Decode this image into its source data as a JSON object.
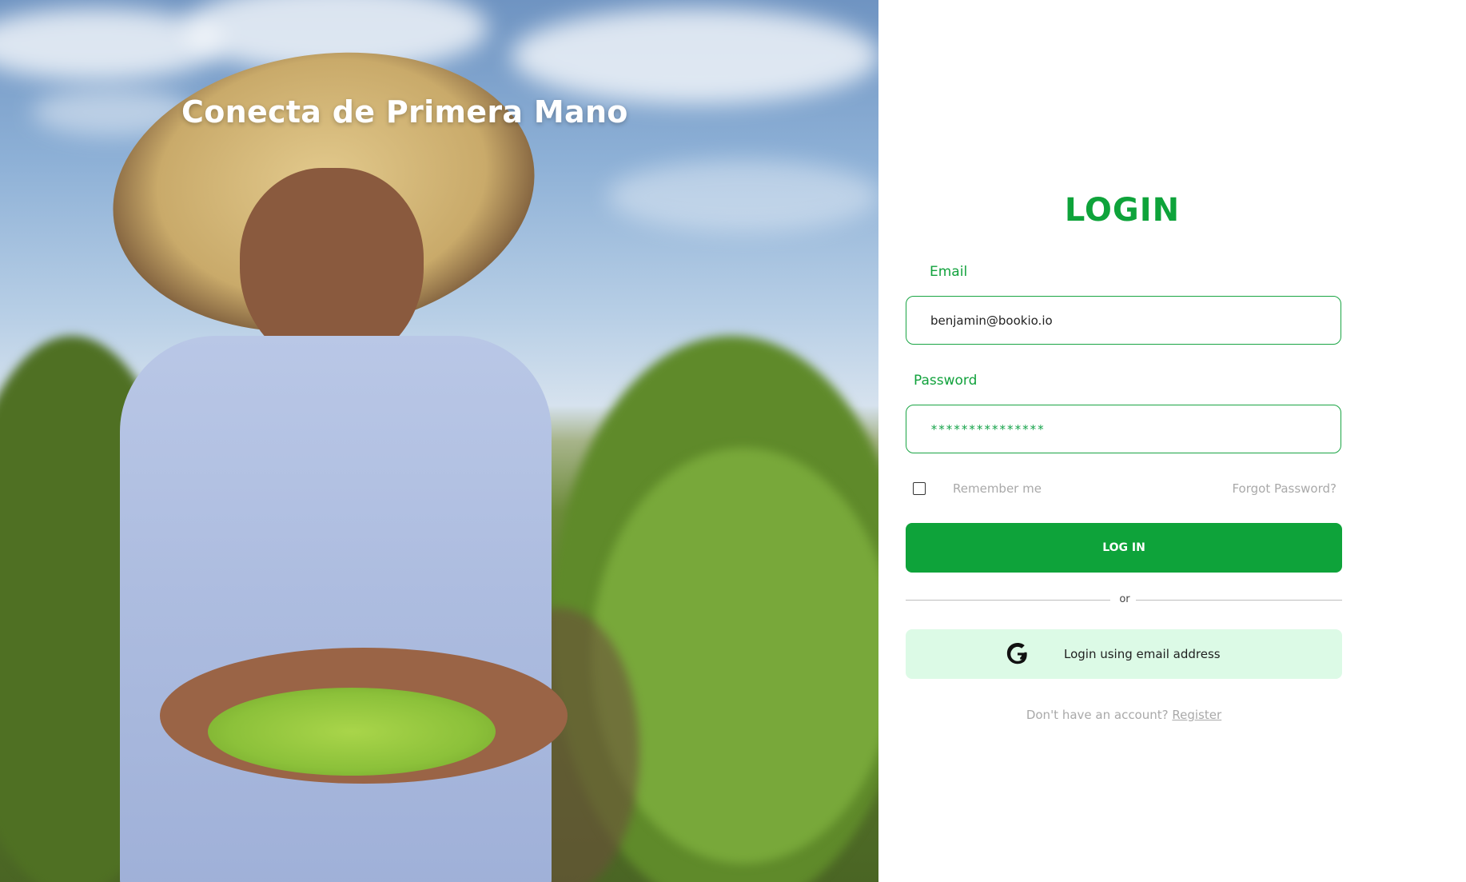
{
  "hero": {
    "title": "Conecta de Primera Mano"
  },
  "login": {
    "title": "LOGIN",
    "email_label": "Email",
    "email_value": "benjamin@bookio.io",
    "password_label": "Password",
    "password_masked": "***************",
    "remember_label": "Remember me",
    "forgot_label": "Forgot Password?",
    "submit_label": "LOG IN",
    "divider_text": "or",
    "google_label": "Login using email address",
    "signup_prompt": "Don't have an account?",
    "register_label": "Register"
  },
  "colors": {
    "accent": "#0ea33a",
    "google_bg": "#dcfae6",
    "muted_text": "#a9a9a9"
  },
  "icons": {
    "google": "google-g-icon",
    "checkbox": "checkbox-unchecked"
  }
}
